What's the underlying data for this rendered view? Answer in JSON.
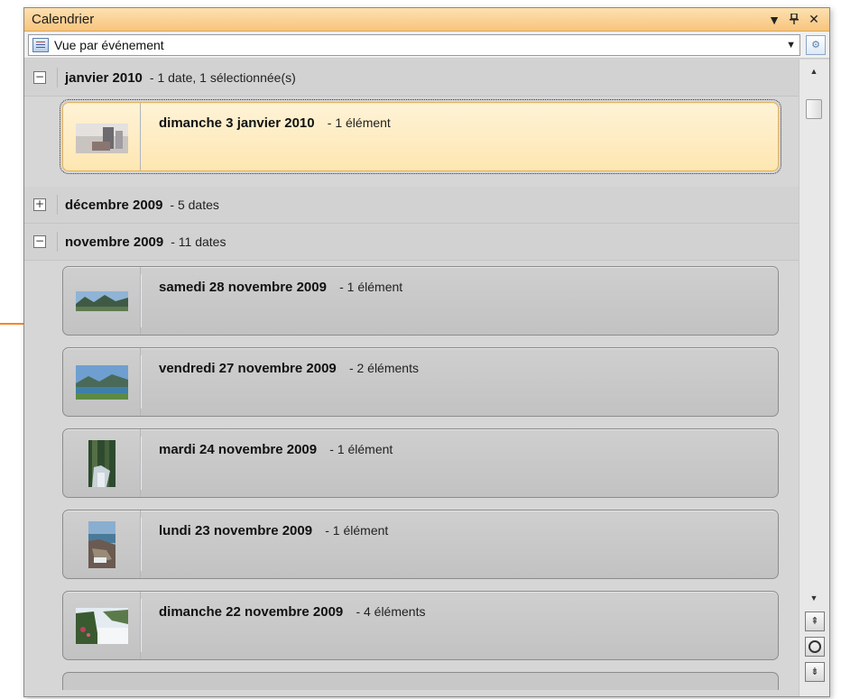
{
  "panel": {
    "title": "Calendrier",
    "controls": {
      "dropdown": "▼",
      "pin": "ꟷ",
      "close": "✕"
    }
  },
  "toolbar": {
    "view_label": "Vue par événement",
    "view_icon": "calendar-view-icon",
    "settings_icon": "settings-icon"
  },
  "groups": [
    {
      "title": "janvier 2010",
      "count": "- 1 date, 1 sélectionnée(s)",
      "expanded": true,
      "dates": [
        {
          "title": "dimanche 3 janvier 2010",
          "count": "- 1 élément",
          "selected": true,
          "thumb": "room"
        }
      ]
    },
    {
      "title": "décembre 2009",
      "count": "- 5 dates",
      "expanded": false,
      "dates": []
    },
    {
      "title": "novembre 2009",
      "count": "- 11 dates",
      "expanded": true,
      "dates": [
        {
          "title": "samedi 28 novembre 2009",
          "count": "- 1 élément",
          "selected": false,
          "thumb": "mountains"
        },
        {
          "title": "vendredi 27 novembre 2009",
          "count": "- 2 éléments",
          "selected": false,
          "thumb": "lake"
        },
        {
          "title": "mardi 24 novembre 2009",
          "count": "- 1 élément",
          "selected": false,
          "thumb": "forest"
        },
        {
          "title": "lundi 23 novembre 2009",
          "count": "- 1 élément",
          "selected": false,
          "thumb": "coast"
        },
        {
          "title": "dimanche 22 novembre 2009",
          "count": "- 4 éléments",
          "selected": false,
          "thumb": "flowers"
        }
      ]
    }
  ],
  "toggle_symbols": {
    "expanded": "−",
    "collapsed": "+"
  },
  "scroll": {
    "up_icon": "▲",
    "down_icon": "▼",
    "nav_top": "⇞",
    "nav_bottom": "⇟"
  },
  "colors": {
    "accent": "#f08a2b",
    "title_bar": "#f8c47d",
    "selected_card": "#fde6b2"
  }
}
